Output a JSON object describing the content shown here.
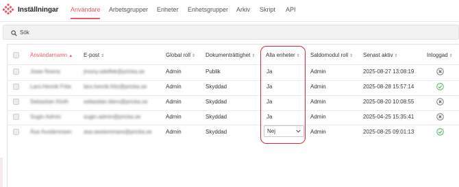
{
  "app": {
    "title": "Inställningar"
  },
  "nav": [
    {
      "label": "Användare",
      "active": true
    },
    {
      "label": "Arbetsgrupper"
    },
    {
      "label": "Enheter"
    },
    {
      "label": "Enhetsgrupper"
    },
    {
      "label": "Arkiv"
    },
    {
      "label": "Skript"
    },
    {
      "label": "API"
    }
  ],
  "search": {
    "placeholder": "Sök",
    "value": ""
  },
  "table": {
    "headers": [
      {
        "label": "Användarnamn",
        "sort": "▲"
      },
      {
        "label": "E-post",
        "sort": "⇕"
      },
      {
        "label": "Global roll",
        "sort": "⇕"
      },
      {
        "label": "Dokumenträttighet",
        "sort": "⇕"
      },
      {
        "label": "Alla enheter",
        "sort": "⇕"
      },
      {
        "label": "Saldomodul roll",
        "sort": "⇕"
      },
      {
        "label": "Senast aktiv",
        "sort": "⇕"
      },
      {
        "label": "Inloggad",
        "sort": "⇕"
      }
    ],
    "rows": [
      {
        "username": "Jowe Noens",
        "email": "jmony.odeflek@pricka.se",
        "role": "Admin",
        "docs": "Publik",
        "all_units": "Ja",
        "saldo": "Admin",
        "last_active": "2025-08-27 13:08:19",
        "logged_in": false
      },
      {
        "username": "Lars-Henrik Frita",
        "email": "lars.henrik.fritz@pricka.se",
        "role": "Admin",
        "docs": "Skyddad",
        "all_units": "Ja",
        "saldo": "Admin",
        "last_active": "2025-08-28 15:57:14",
        "logged_in": true
      },
      {
        "username": "Sebastian Kloth",
        "email": "sebastian.klerv@pricka.se",
        "role": "Admin",
        "docs": "Skyddad",
        "all_units": "Ja",
        "saldo": "Admin",
        "last_active": "2025-08-20 10:08:55",
        "logged_in": false
      },
      {
        "username": "Sugin Admin",
        "email": "sugin.admin@pricka.se",
        "role": "Admin",
        "docs": "Skyddad",
        "all_units": "Ja",
        "saldo": "Admin",
        "last_active": "2025-04-25 15:35:41",
        "logged_in": false
      },
      {
        "username": "Åsa Austärnnsen",
        "email": "asa.aestemmare@pricka.se",
        "role": "Admin",
        "docs": "Skyddad",
        "all_units": "Nej",
        "saldo": "Admin",
        "last_active": "2025-08-25 09:01:13",
        "logged_in": true
      }
    ]
  },
  "colors": {
    "accent": "#e85a6b",
    "highlight": "#e1232f",
    "ok": "#4caf50",
    "off": "#777777"
  }
}
